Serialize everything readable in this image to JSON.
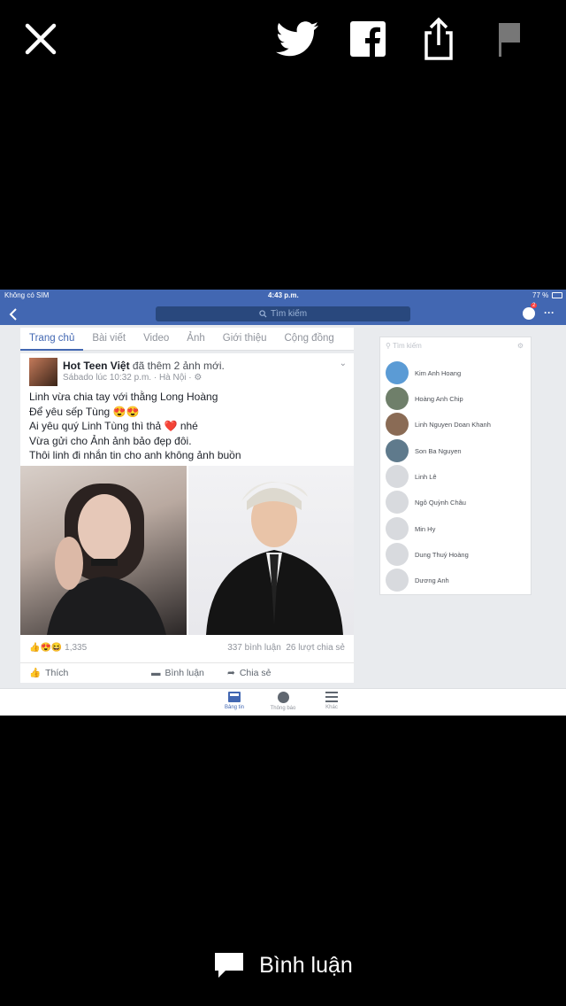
{
  "viewer": {
    "icons": {
      "close": "close-icon",
      "twitter": "twitter-icon",
      "facebook": "facebook-icon",
      "share": "share-icon",
      "flag": "flag-icon"
    },
    "comment_label": "Bình luận"
  },
  "phone": {
    "status": {
      "carrier": "Không có SIM",
      "time": "4:43 p.m.",
      "battery": "77 %"
    },
    "search_placeholder": "Tìm kiếm",
    "messenger_badge": "2",
    "tabs": [
      "Trang chủ",
      "Bài viết",
      "Video",
      "Ảnh",
      "Giới thiệu",
      "Cộng đồng"
    ],
    "post": {
      "author": "Hot Teen Việt",
      "action": "đã thêm 2 ảnh mới.",
      "meta": "Sábado lúc 10:32 p.m. · Hà Nội ·",
      "lines": [
        "Linh vừa chia tay với thằng Long Hoàng",
        "Để yêu sếp Tùng 😍😍",
        "Ai yêu quý Linh Tùng thì thả ❤️ nhé",
        "Vừa gửi cho Ảnh ảnh bảo đẹp đôi.",
        "Thôi linh đi nhắn tin cho anh không ảnh buồn"
      ],
      "reactions_count": "1,335",
      "comments": "337 bình luận",
      "shares": "26 lượt chia sẻ",
      "like_label": "Thích",
      "comment_label": "Bình luận",
      "share_label": "Chia sẻ"
    },
    "sidebar": {
      "search_placeholder": "Tìm kiếm",
      "contacts": [
        "Kim Anh Hoang",
        "Hoàng Anh Chip",
        "Linh Nguyen Doan Khanh",
        "Son Ba Nguyen",
        "Linh Lê",
        "Ngô Quỳnh Châu",
        "Min Hy",
        "Dung Thuý Hoàng",
        "Dương Anh"
      ]
    },
    "bottom_nav": {
      "news": "Bảng tin",
      "notifications": "Thông báo",
      "more": "Khác"
    }
  },
  "colors": {
    "fb_blue": "#4267b2",
    "fb_dark": "#29487d",
    "background": "#000000"
  }
}
